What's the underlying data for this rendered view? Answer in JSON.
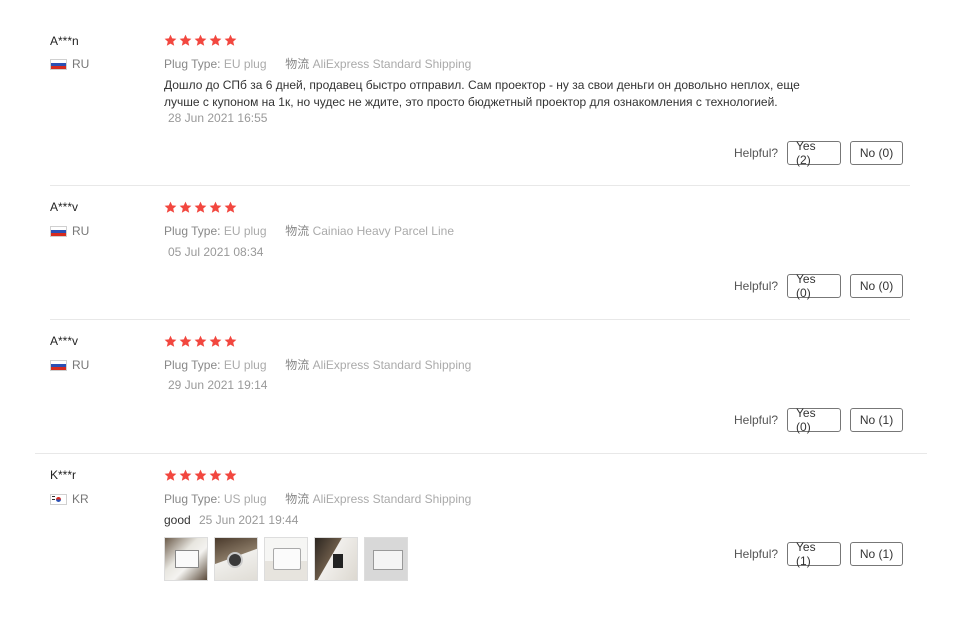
{
  "helpful_label": "Helpful?",
  "plug_key": "Plug Type:",
  "logistics_key": "物流",
  "reviews": [
    {
      "user": "A***n",
      "country": "RU",
      "rating": 5,
      "plug": "EU plug",
      "shipping": "AliExpress Standard Shipping",
      "text_line1": "Дошло до СПб за 6 дней, продавец быстро отправил. Сам проектор - ну за свои деньги он довольно неплох, еще",
      "text_line2": "лучше с купоном на 1к, но чудес не ждите, это просто бюджетный проектор для ознакомления с технологией.",
      "date": "28 Jun 2021 16:55",
      "yes": "Yes (2)",
      "no": "No (0)"
    },
    {
      "user": "A***v",
      "country": "RU",
      "rating": 5,
      "plug": "EU plug",
      "shipping": "Cainiao Heavy Parcel Line",
      "date": "05 Jul 2021 08:34",
      "yes": "Yes (0)",
      "no": "No (0)"
    },
    {
      "user": "A***v",
      "country": "RU",
      "rating": 5,
      "plug": "EU plug",
      "shipping": "AliExpress Standard Shipping",
      "date": "29 Jun 2021 19:14",
      "yes": "Yes (0)",
      "no": "No (1)"
    },
    {
      "user": "K***r",
      "country": "KR",
      "rating": 5,
      "plug": "US plug",
      "shipping": "AliExpress Standard Shipping",
      "text": "good",
      "date": "25 Jun 2021 19:44",
      "photos": 5,
      "yes": "Yes (1)",
      "no": "No (1)"
    }
  ],
  "colors": {
    "star": "#f2473f",
    "separator": "#e8e8e8"
  }
}
